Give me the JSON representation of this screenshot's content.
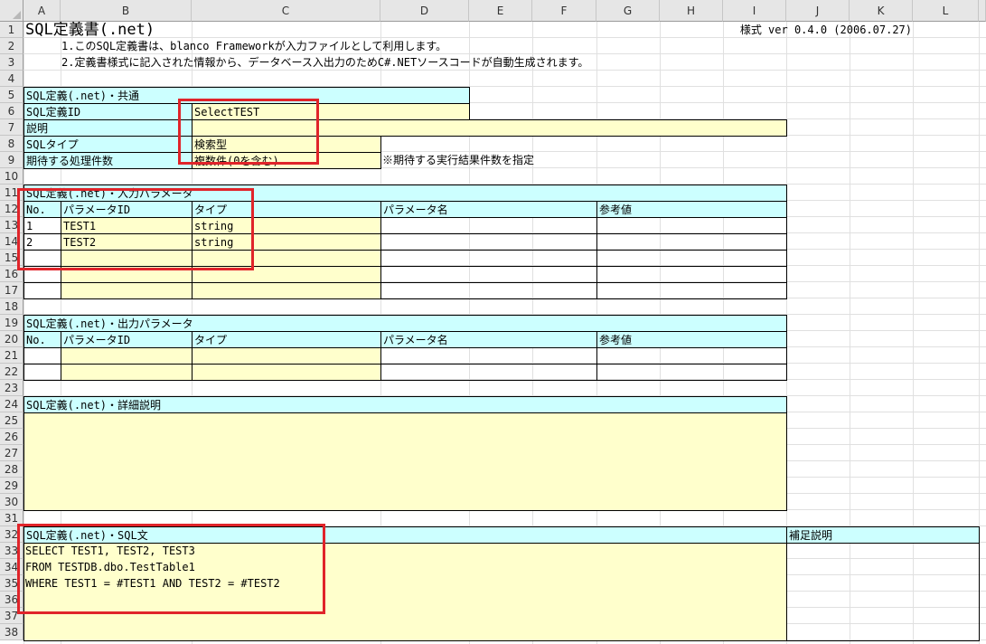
{
  "columns": [
    "A",
    "B",
    "C",
    "D",
    "E",
    "F",
    "G",
    "H",
    "I",
    "J",
    "K",
    "L"
  ],
  "rows": [
    "1",
    "2",
    "3",
    "4",
    "5",
    "6",
    "7",
    "8",
    "9",
    "10",
    "11",
    "12",
    "13",
    "14",
    "15",
    "16",
    "17",
    "18",
    "19",
    "20",
    "21",
    "22",
    "23",
    "24",
    "25",
    "26",
    "27",
    "28",
    "29",
    "30",
    "31",
    "32",
    "33",
    "34",
    "35",
    "36",
    "37",
    "38"
  ],
  "header": {
    "title": "SQL定義書(.net)",
    "version": "様式 ver 0.4.0 (2006.07.27)",
    "desc1": "1.このSQL定義書は、blanco Frameworkが入力ファイルとして利用します。",
    "desc2": "2.定義書様式に記入された情報から、データベース入出力のためC#.NETソースコードが自動生成されます。"
  },
  "common": {
    "section": "SQL定義(.net)・共通",
    "id_label": "SQL定義ID",
    "id_value": "SelectTEST",
    "desc_label": "説明",
    "desc_value": "",
    "type_label": "SQLタイプ",
    "type_value": "検索型",
    "count_label": "期待する処理件数",
    "count_value": "複数件(0を含む)",
    "count_note": "※期待する実行結果件数を指定"
  },
  "input_params": {
    "section": "SQL定義(.net)・入力パラメータ",
    "headers": {
      "no": "No.",
      "id": "パラメータID",
      "type": "タイプ",
      "name": "パラメータ名",
      "ref": "参考値"
    },
    "rows": [
      {
        "no": "1",
        "id": "TEST1",
        "type": "string",
        "name": "",
        "ref": ""
      },
      {
        "no": "2",
        "id": "TEST2",
        "type": "string",
        "name": "",
        "ref": ""
      },
      {
        "no": "",
        "id": "",
        "type": "",
        "name": "",
        "ref": ""
      },
      {
        "no": "",
        "id": "",
        "type": "",
        "name": "",
        "ref": ""
      },
      {
        "no": "",
        "id": "",
        "type": "",
        "name": "",
        "ref": ""
      }
    ]
  },
  "output_params": {
    "section": "SQL定義(.net)・出力パラメータ",
    "headers": {
      "no": "No.",
      "id": "パラメータID",
      "type": "タイプ",
      "name": "パラメータ名",
      "ref": "参考値"
    },
    "rows": [
      {
        "no": "",
        "id": "",
        "type": "",
        "name": "",
        "ref": ""
      },
      {
        "no": "",
        "id": "",
        "type": "",
        "name": "",
        "ref": ""
      }
    ]
  },
  "detail": {
    "section": "SQL定義(.net)・詳細説明",
    "text": ""
  },
  "sql": {
    "section": "SQL定義(.net)・SQL文",
    "supplement_label": "補足説明",
    "lines": [
      "SELECT TEST1, TEST2, TEST3",
      "FROM TESTDB.dbo.TestTable1",
      "WHERE TEST1 =  #TEST1 AND TEST2 = #TEST2"
    ]
  },
  "colors": {
    "section_fill": "#ccffff",
    "input_fill": "#ffffcc",
    "highlight": "#e0242a",
    "header_bg": "#e6e6e6"
  }
}
